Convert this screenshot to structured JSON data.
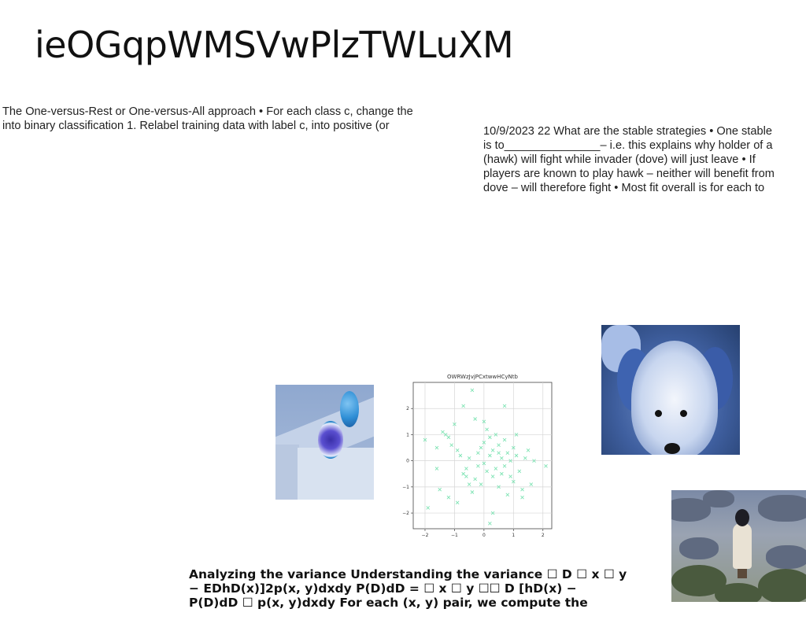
{
  "slide": {
    "title": "ieOGqpWMSVwPlzTWLuXM"
  },
  "text_left": {
    "lines": [
      "The One-versus-Rest or One-versus-All approach • For each class c, change the",
      "into binary classification 1. Relabel training data with label c, into positive (or"
    ]
  },
  "text_right": {
    "lines": [
      "10/9/2023 22 What are the stable strategies • One stable",
      "is to_______________– i.e. this explains why holder of a",
      "(hawk) will fight while invader (dove) will just leave • If",
      "players are known to play hawk – neither will benefit from",
      "dove – will therefore fight • Most fit overall is for each to"
    ]
  },
  "text_bottom": {
    "lines": [
      "Analyzing the variance Understanding the variance ☐ D ☐ x ☐ y",
      "− EDhD(x)]2p(x, y)dxdy P(D)dD = ☐ x ☐ y ☐☐ D [hD(x) −",
      "P(D)dD ☐ p(x, y)dxdy For each (x, y) pair, we compute the"
    ]
  },
  "images": {
    "fruit": "photo of a blue grapefruit on a box",
    "dog": "photo of a fluffy dog",
    "landscape": "photo of a person on rocky terrain"
  },
  "chart_data": {
    "type": "scatter",
    "title": "OWRWzJvjPCxtwwHCyNtb",
    "xlim": [
      -2.4,
      2.3
    ],
    "ylim": [
      -2.6,
      3.0
    ],
    "xticks": [
      -2,
      -1,
      0,
      1,
      2
    ],
    "yticks": [
      -2,
      -1,
      0,
      1,
      2
    ],
    "grid": true,
    "marker": "x",
    "color": "#7fe3b4",
    "points": [
      [
        -1.9,
        -1.8
      ],
      [
        -2.0,
        0.8
      ],
      [
        -1.6,
        0.5
      ],
      [
        -1.4,
        1.1
      ],
      [
        -1.3,
        1.0
      ],
      [
        -1.2,
        0.9
      ],
      [
        -1.1,
        0.6
      ],
      [
        -1.0,
        1.4
      ],
      [
        -0.9,
        0.4
      ],
      [
        -0.8,
        0.2
      ],
      [
        -0.7,
        -0.5
      ],
      [
        -0.6,
        -0.3
      ],
      [
        -0.5,
        0.1
      ],
      [
        -0.5,
        -0.9
      ],
      [
        -0.4,
        -1.2
      ],
      [
        -0.3,
        -0.7
      ],
      [
        -0.2,
        0.3
      ],
      [
        -0.2,
        -0.2
      ],
      [
        -0.1,
        0.5
      ],
      [
        0.0,
        -0.1
      ],
      [
        0.0,
        0.7
      ],
      [
        0.1,
        1.2
      ],
      [
        0.1,
        -0.4
      ],
      [
        0.2,
        0.2
      ],
      [
        0.2,
        0.9
      ],
      [
        0.3,
        -0.6
      ],
      [
        0.3,
        0.4
      ],
      [
        0.4,
        1.0
      ],
      [
        0.4,
        -0.3
      ],
      [
        0.5,
        0.6
      ],
      [
        0.5,
        -1.0
      ],
      [
        0.6,
        0.1
      ],
      [
        0.6,
        -0.5
      ],
      [
        0.7,
        0.8
      ],
      [
        0.7,
        -0.2
      ],
      [
        0.8,
        0.3
      ],
      [
        0.8,
        -1.3
      ],
      [
        0.9,
        0.0
      ],
      [
        1.0,
        0.5
      ],
      [
        1.0,
        -0.8
      ],
      [
        1.1,
        0.2
      ],
      [
        1.2,
        -0.4
      ],
      [
        1.3,
        -1.1
      ],
      [
        1.4,
        0.1
      ],
      [
        1.5,
        0.4
      ],
      [
        1.6,
        -0.9
      ],
      [
        1.7,
        0.0
      ],
      [
        2.1,
        -0.2
      ],
      [
        -0.7,
        2.1
      ],
      [
        -0.4,
        2.7
      ],
      [
        0.7,
        2.1
      ],
      [
        -1.5,
        -1.1
      ],
      [
        -1.2,
        -1.4
      ],
      [
        0.3,
        -2.0
      ],
      [
        0.2,
        -2.4
      ],
      [
        -1.6,
        -0.3
      ],
      [
        1.3,
        -1.4
      ],
      [
        -0.3,
        1.6
      ],
      [
        0.0,
        1.5
      ],
      [
        -0.9,
        -1.6
      ],
      [
        1.1,
        1.0
      ],
      [
        -0.6,
        -0.6
      ],
      [
        0.9,
        -0.6
      ],
      [
        -0.1,
        -0.9
      ],
      [
        0.5,
        0.3
      ]
    ]
  }
}
